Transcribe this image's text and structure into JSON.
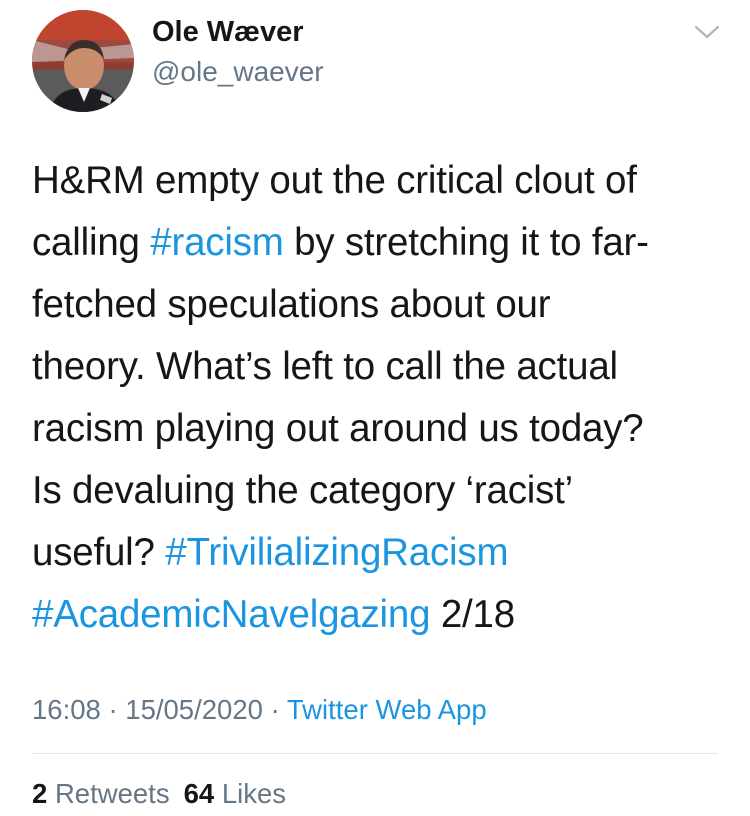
{
  "author": {
    "name": "Ole Wæver",
    "handle": "@ole_waever"
  },
  "tweet": {
    "lines": [
      [
        {
          "text": "H&RM empty out the critical clout of"
        }
      ],
      [
        {
          "text": "calling "
        },
        {
          "text": "#racism",
          "hashtag": true
        },
        {
          "text": " by stretching it to far-"
        }
      ],
      [
        {
          "text": "fetched speculations about our"
        }
      ],
      [
        {
          "text": "theory. What’s left to call the actual"
        }
      ],
      [
        {
          "text": "racism playing out around us today?"
        }
      ],
      [
        {
          "text": "Is devaluing the category ‘racist’"
        }
      ],
      [
        {
          "text": "useful? "
        },
        {
          "text": "#TrivilializingRacism",
          "hashtag": true
        }
      ],
      [
        {
          "text": "#AcademicNavelgazing",
          "hashtag": true
        },
        {
          "text": " 2/18"
        }
      ]
    ],
    "time": "16:08",
    "date": "15/05/2020",
    "separator": "·",
    "source": "Twitter Web App"
  },
  "stats": {
    "retweets_count": "2",
    "retweets_label": "Retweets",
    "likes_count": "64",
    "likes_label": "Likes"
  },
  "icons": {
    "menu": "chevron-down-icon"
  },
  "colors": {
    "hashtag": "#1b95e0",
    "secondary_text": "#657786",
    "primary_text": "#14171a",
    "divider": "#e1e8ed"
  }
}
